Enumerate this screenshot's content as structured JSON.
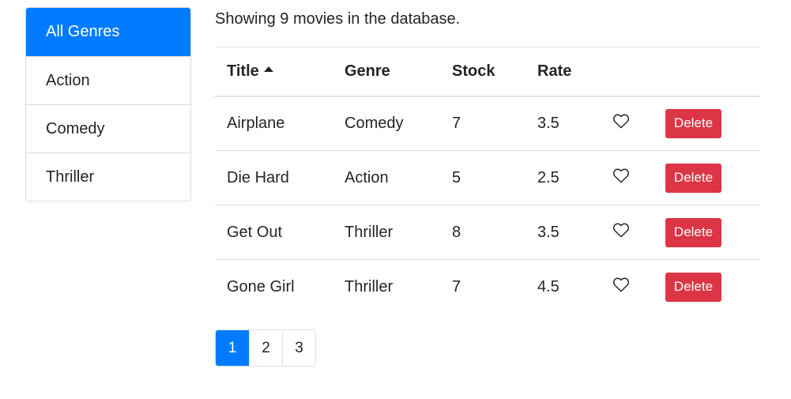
{
  "genres": {
    "items": [
      {
        "label": "All Genres",
        "active": true
      },
      {
        "label": "Action",
        "active": false
      },
      {
        "label": "Comedy",
        "active": false
      },
      {
        "label": "Thriller",
        "active": false
      }
    ]
  },
  "summary": {
    "text": "Showing 9 movies in the database."
  },
  "table": {
    "headers": {
      "title": "Title",
      "genre": "Genre",
      "stock": "Stock",
      "rate": "Rate"
    },
    "sort_icon": "caret-up-icon",
    "rows": [
      {
        "title": "Airplane",
        "genre": "Comedy",
        "stock": "7",
        "rate": "3.5",
        "delete_label": "Delete"
      },
      {
        "title": "Die Hard",
        "genre": "Action",
        "stock": "5",
        "rate": "2.5",
        "delete_label": "Delete"
      },
      {
        "title": "Get Out",
        "genre": "Thriller",
        "stock": "8",
        "rate": "3.5",
        "delete_label": "Delete"
      },
      {
        "title": "Gone Girl",
        "genre": "Thriller",
        "stock": "7",
        "rate": "4.5",
        "delete_label": "Delete"
      }
    ],
    "like_icon": "heart-outline-icon"
  },
  "pagination": {
    "pages": [
      "1",
      "2",
      "3"
    ],
    "current": "1"
  },
  "colors": {
    "primary": "#007bff",
    "danger": "#dc3545",
    "border": "#dee2e6"
  }
}
